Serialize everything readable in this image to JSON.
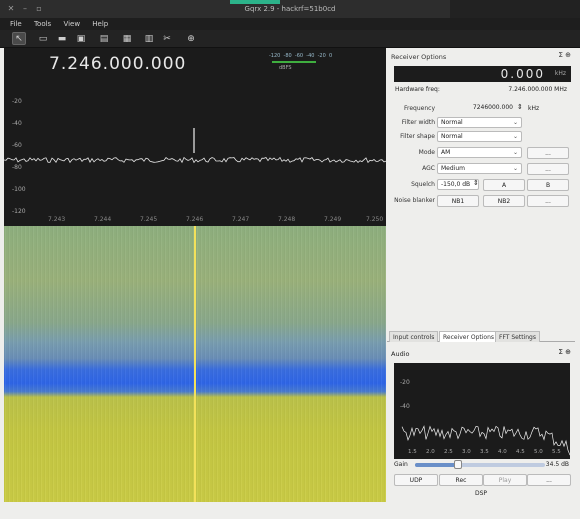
{
  "window": {
    "title": "Gqrx 2.9 - hackrf=51b0cd",
    "close_icon": "close-icon",
    "min_icon": "minimize-icon",
    "max_icon": "maximize-icon"
  },
  "menu": {
    "file": "File",
    "tools": "Tools",
    "view": "View",
    "help": "Help"
  },
  "toolbar": {
    "icons": [
      "pointer-icon",
      "hardware-icon",
      "folder-icon",
      "save-icon",
      "bookmark-icon",
      "screen-icon",
      "config-icon",
      "tools-icon",
      "crosshair-icon"
    ]
  },
  "spectrum": {
    "frequency_display": "7.246.000.000",
    "meter_scale": [
      "-120",
      "-80",
      "-60",
      "-40",
      "-20",
      "0"
    ],
    "meter_unit": "dBFS",
    "y_ticks": [
      "-20",
      "-40",
      "-60",
      "-80",
      "-100",
      "-120"
    ],
    "x_ticks": [
      "7.243",
      "7.244",
      "7.245",
      "7.246",
      "7.247",
      "7.248",
      "7.249",
      "7.250"
    ]
  },
  "receiver_options": {
    "header": "Receiver Options",
    "header_icons": "Σ ⊕",
    "display_value": "0.000",
    "display_unit": "kHz",
    "hardware_freq_label": "Hardware freq:",
    "hardware_freq_value": "7.246.000.000 MHz",
    "frequency_label": "Frequency",
    "frequency_value": "7246000.000",
    "frequency_unit": "kHz",
    "filter_width_label": "Filter width",
    "filter_width_value": "Normal",
    "filter_shape_label": "Filter shape",
    "filter_shape_value": "Normal",
    "mode_label": "Mode",
    "mode_value": "AM",
    "mode_btn": "...",
    "agc_label": "AGC",
    "agc_value": "Medium",
    "agc_btn": "...",
    "squelch_label": "Squelch",
    "squelch_value": "-150,0 dB",
    "squelch_a": "A",
    "squelch_b": "B",
    "nb_label": "Noise blanker",
    "nb1": "NB1",
    "nb2": "NB2",
    "nb_btn": "..."
  },
  "tabs": [
    "Input controls",
    "Receiver Options",
    "FFT Settings"
  ],
  "audio": {
    "header": "Audio",
    "y_ticks": [
      "-20",
      "-40"
    ],
    "x_ticks": [
      "1.5",
      "2.0",
      "2.5",
      "3.0",
      "3.5",
      "4.0",
      "4.5",
      "5.0",
      "5.5"
    ],
    "gain_label": "Gain",
    "gain_value": "34.5 dB",
    "gain_level": 0.33,
    "udp": "UDP",
    "rec": "Rec",
    "play": "Play",
    "more": "...",
    "dsp": "DSP"
  }
}
